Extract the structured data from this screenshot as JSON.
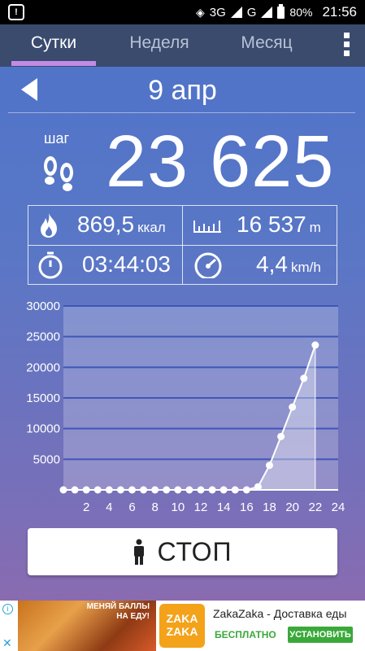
{
  "status_bar": {
    "app_icon": "notification-app-icon",
    "network": "3G",
    "network2": "G",
    "battery": "80%",
    "time": "21:56"
  },
  "tabs": [
    {
      "label": "Сутки",
      "active": true
    },
    {
      "label": "Неделя",
      "active": false
    },
    {
      "label": "Месяц",
      "active": false
    }
  ],
  "date": "9 апр",
  "steps": {
    "label": "шаг",
    "value": "23 625"
  },
  "stats": {
    "calories": {
      "value": "869,5",
      "unit": "ккал"
    },
    "distance": {
      "value": "16 537",
      "unit": "m"
    },
    "duration": {
      "value": "03:44:03",
      "unit": ""
    },
    "speed": {
      "value": "4,4",
      "unit": "km/h"
    }
  },
  "chart_data": {
    "type": "area",
    "title": "",
    "xlabel": "",
    "ylabel": "",
    "x_ticks": [
      "2",
      "4",
      "6",
      "8",
      "10",
      "12",
      "14",
      "16",
      "18",
      "20",
      "22",
      "24"
    ],
    "y_ticks": [
      "5000",
      "10000",
      "15000",
      "20000",
      "25000",
      "30000"
    ],
    "xlim": [
      0,
      24
    ],
    "ylim": [
      0,
      30000
    ],
    "grid": true,
    "series": [
      {
        "x": [
          0,
          1,
          2,
          3,
          4,
          5,
          6,
          7,
          8,
          9,
          10,
          11,
          12,
          13,
          14,
          15,
          16,
          17,
          18,
          19,
          20,
          21,
          22
        ],
        "values": [
          0,
          0,
          0,
          0,
          0,
          0,
          0,
          0,
          0,
          0,
          0,
          0,
          0,
          0,
          0,
          0,
          0,
          500,
          4000,
          8700,
          13500,
          18200,
          23625
        ]
      }
    ]
  },
  "stop_button": {
    "label": "СТОП"
  },
  "ad": {
    "tagline": "МЕНЯЙ БАЛЛЫ НА ЕДУ!",
    "logo_text": "ZAKA ZAKA",
    "title": "ZakaZaka - Доставка еды",
    "free_label": "БЕСПЛАТНО",
    "install_label": "УСТАНОВИТЬ"
  }
}
